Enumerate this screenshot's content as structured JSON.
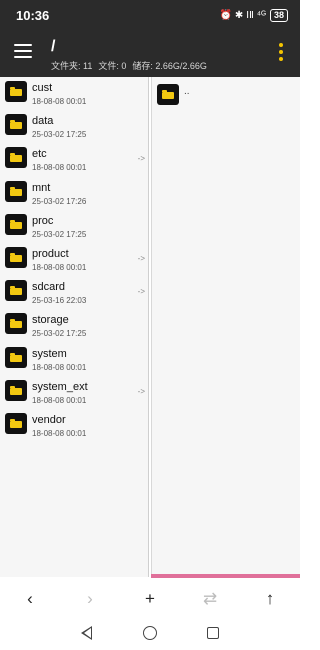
{
  "status_bar": {
    "time": "10:36",
    "icons": [
      "alarm-icon",
      "vibrate-icon",
      "nfc-icon",
      "signal-icon"
    ],
    "icons_text": "⏰ ✱ ⅠⅡ ⁴ᴳ",
    "battery": "38"
  },
  "header": {
    "path": "/",
    "folders_label": "文件夹: 11",
    "files_label": "文件: 0",
    "storage_label": "储存: 2.66G/2.66G"
  },
  "left_pane": {
    "items": [
      {
        "name": "cust",
        "date": "18-08-08 00:01",
        "link": ""
      },
      {
        "name": "data",
        "date": "25-03-02 17:25",
        "link": ""
      },
      {
        "name": "etc",
        "date": "18-08-08 00:01",
        "link": "->"
      },
      {
        "name": "mnt",
        "date": "25-03-02 17:26",
        "link": ""
      },
      {
        "name": "proc",
        "date": "25-03-02 17:25",
        "link": ""
      },
      {
        "name": "product",
        "date": "18-08-08 00:01",
        "link": "->"
      },
      {
        "name": "sdcard",
        "date": "25-03-16 22:03",
        "link": "->"
      },
      {
        "name": "storage",
        "date": "25-03-02 17:25",
        "link": ""
      },
      {
        "name": "system",
        "date": "18-08-08 00:01",
        "link": ""
      },
      {
        "name": "system_ext",
        "date": "18-08-08 00:01",
        "link": "->"
      },
      {
        "name": "vendor",
        "date": "18-08-08 00:01",
        "link": ""
      }
    ]
  },
  "right_pane": {
    "parent_label": ".."
  },
  "toolbar": {
    "back": "‹",
    "forward": "›",
    "add": "+",
    "swap": "⇄",
    "up": "↑"
  },
  "colors": {
    "header_bg": "#2b2b2b",
    "accent": "#f4c400",
    "folder": "#f2c811",
    "divider_active": "#e0709a"
  }
}
